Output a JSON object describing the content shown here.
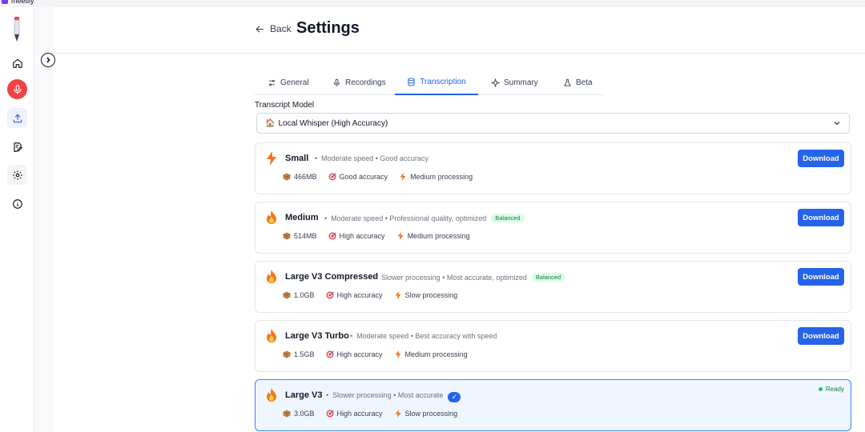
{
  "app": {
    "title": "meetily"
  },
  "sidebar": {
    "items": [
      {
        "id": "home",
        "icon": "home-icon"
      },
      {
        "id": "record",
        "icon": "microphone-icon"
      },
      {
        "id": "upload",
        "icon": "upload-icon"
      },
      {
        "id": "notes",
        "icon": "edit-note-icon"
      },
      {
        "id": "settings",
        "icon": "gear-icon"
      },
      {
        "id": "info",
        "icon": "info-icon"
      }
    ]
  },
  "header": {
    "back_label": "Back",
    "title": "Settings"
  },
  "tabs": [
    {
      "label": "General",
      "icon": "sliders-icon",
      "active": false
    },
    {
      "label": "Recordings",
      "icon": "microphone-icon",
      "active": false
    },
    {
      "label": "Transcription",
      "icon": "database-icon",
      "active": true
    },
    {
      "label": "Summary",
      "icon": "sparkle-icon",
      "active": false
    },
    {
      "label": "Beta",
      "icon": "flask-icon",
      "active": false
    }
  ],
  "transcript_model": {
    "label": "Transcript Model",
    "selected": "Local Whisper (High Accuracy)",
    "selected_emoji": "🏠"
  },
  "models": [
    {
      "name": "Small",
      "icon": "lightning-icon",
      "desc": "Moderate speed • Good accuracy",
      "badge": "",
      "size": "466MB",
      "accuracy": "Good accuracy",
      "processing": "Medium processing",
      "action": "Download",
      "selected": false
    },
    {
      "name": "Medium",
      "icon": "fire-icon",
      "desc": "Moderate speed • Professional quality, optimized",
      "badge": "Balanced",
      "size": "514MB",
      "accuracy": "High accuracy",
      "processing": "Medium processing",
      "action": "Download",
      "selected": false
    },
    {
      "name": "Large V3 Compressed",
      "icon": "fire-icon",
      "desc": "Slower processing • Most accurate, optimized",
      "badge": "Balanced",
      "size": "1.0GB",
      "accuracy": "High accuracy",
      "processing": "Slow processing",
      "action": "Download",
      "selected": false
    },
    {
      "name": "Large V3 Turbo",
      "icon": "fire-icon",
      "desc": "Moderate speed • Best accuracy with speed",
      "badge": "",
      "size": "1.5GB",
      "accuracy": "High accuracy",
      "processing": "Medium processing",
      "action": "Download",
      "selected": false
    },
    {
      "name": "Large V3",
      "icon": "fire-icon",
      "desc": "Slower processing • Most accurate",
      "badge": "",
      "size": "3.0GB",
      "accuracy": "High accuracy",
      "processing": "Slow processing",
      "status": "Ready",
      "selected": true,
      "check": "✓"
    }
  ],
  "colors": {
    "accent": "#2563eb",
    "record": "#ef4444",
    "ready": "#22c55e",
    "badge_bg": "#dcfce7"
  }
}
